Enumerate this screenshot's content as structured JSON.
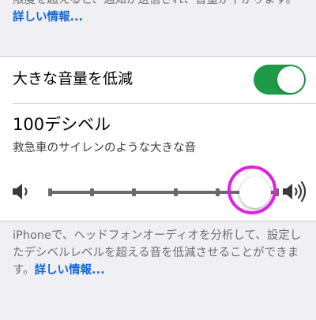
{
  "top_footer": {
    "text": "限度を超えると、通知が送信され、音量が下がります。",
    "link": "詳しい情報..."
  },
  "reduce_loud_audio": {
    "label": "大きな音量を低減",
    "enabled": true,
    "accent_color": "#1d9b47"
  },
  "level": {
    "title": "100デシベル",
    "subtitle": "救急車のサイレンのような大きな音",
    "value_fraction": 0.9
  },
  "bottom_footer": {
    "text": "iPhoneで、ヘッドフォンオーディオを分析して、設定したデシベルレベルを超える音を低減させることができます。",
    "link": "詳しい情報..."
  },
  "icons": {
    "left": "speaker-low-icon",
    "right": "speaker-high-icon"
  }
}
